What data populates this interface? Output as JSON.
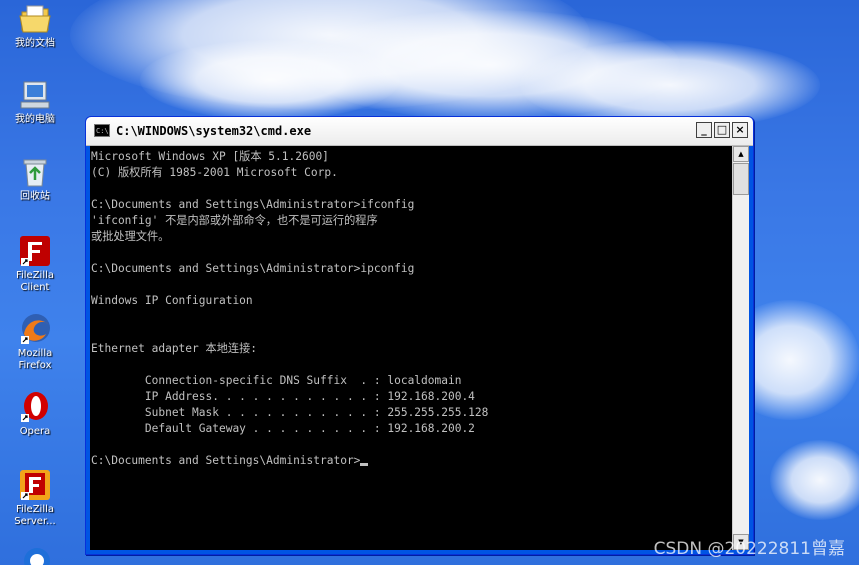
{
  "desktop": {
    "icons": [
      {
        "label": "我的文档",
        "icon": "my-documents-icon"
      },
      {
        "label": "我的电脑",
        "icon": "my-computer-icon"
      },
      {
        "label": "回收站",
        "icon": "recycle-bin-icon"
      },
      {
        "label": "FileZilla Client",
        "icon": "filezilla-client-icon"
      },
      {
        "label": "Mozilla Firefox",
        "icon": "firefox-icon"
      },
      {
        "label": "Opera",
        "icon": "opera-icon"
      },
      {
        "label": "FileZilla Server...",
        "icon": "filezilla-server-icon"
      }
    ]
  },
  "window": {
    "title": "C:\\WINDOWS\\system32\\cmd.exe",
    "icon_text": "C:\\",
    "buttons": {
      "minimize": "_",
      "maximize": "□",
      "close": "×"
    }
  },
  "console": {
    "lines": [
      "Microsoft Windows XP [版本 5.1.2600]",
      "(C) 版权所有 1985-2001 Microsoft Corp.",
      "",
      "C:\\Documents and Settings\\Administrator>ifconfig",
      "'ifconfig' 不是内部或外部命令，也不是可运行的程序",
      "或批处理文件。",
      "",
      "C:\\Documents and Settings\\Administrator>ipconfig",
      "",
      "Windows IP Configuration",
      "",
      "",
      "Ethernet adapter 本地连接:",
      "",
      "        Connection-specific DNS Suffix  . : localdomain",
      "        IP Address. . . . . . . . . . . . : 192.168.200.4",
      "        Subnet Mask . . . . . . . . . . . : 255.255.255.128",
      "        Default Gateway . . . . . . . . . : 192.168.200.2",
      "",
      "C:\\Documents and Settings\\Administrator>"
    ]
  },
  "watermark": "CSDN @20222811曾嘉",
  "colors": {
    "console_bg": "#000000",
    "console_fg": "#c0c0c0",
    "titlebar": "#ffffff",
    "desktop": "#3a78e6"
  }
}
